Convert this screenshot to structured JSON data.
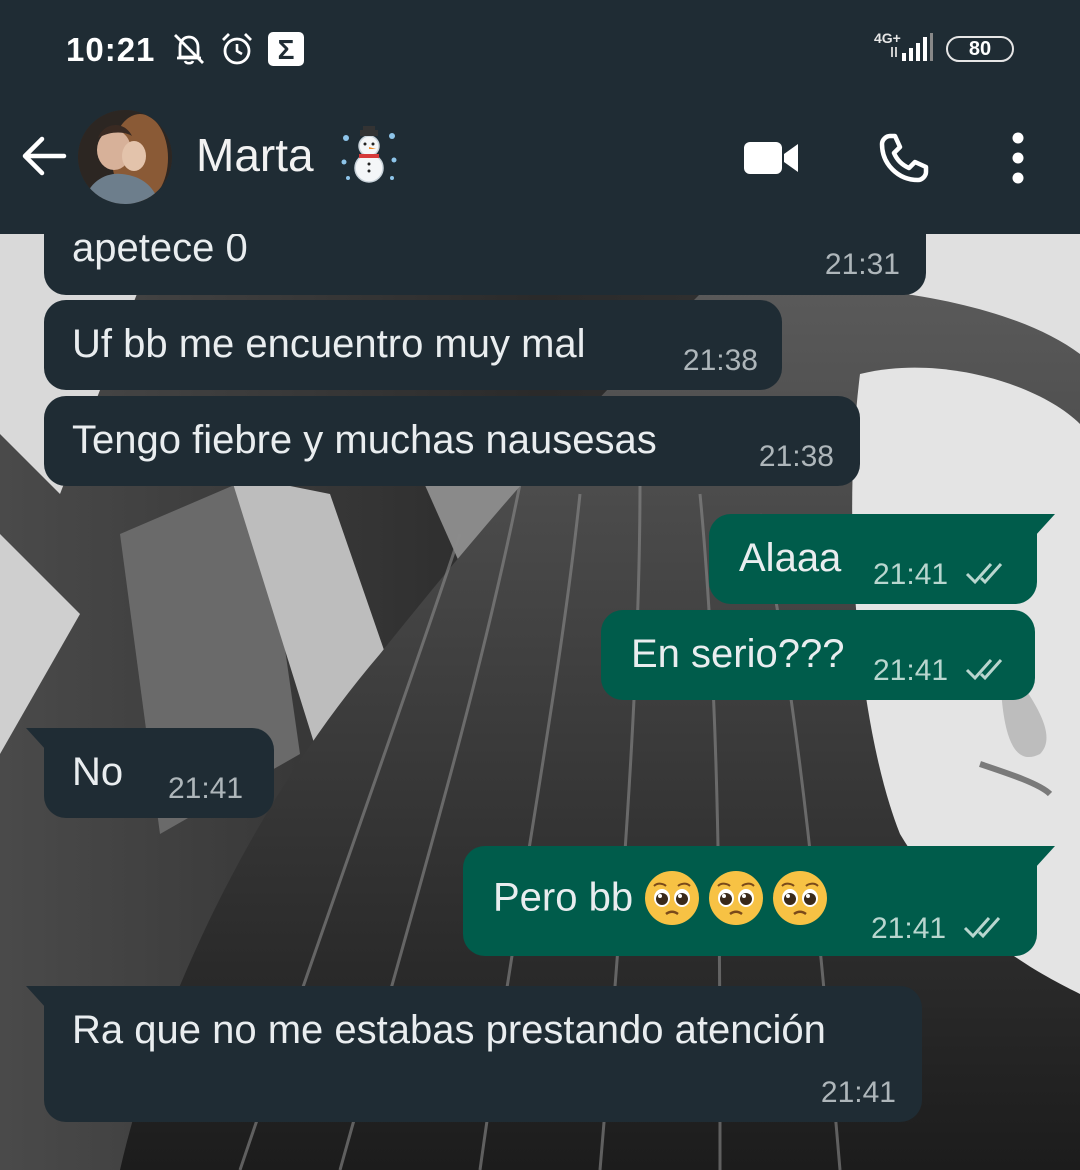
{
  "status_bar": {
    "time": "10:21",
    "network": "4G+",
    "battery": "80",
    "icons": [
      "bell-off-icon",
      "alarm-icon",
      "sigma-icon",
      "signal-icon",
      "battery-icon"
    ]
  },
  "header": {
    "contact_name": "Marta",
    "name_emoji": "snowman-icon",
    "actions": [
      "back-arrow-icon",
      "video-call-icon",
      "voice-call-icon",
      "more-vert-icon"
    ]
  },
  "messages": [
    {
      "dir": "in",
      "text": "apetece 0",
      "time": "21:31"
    },
    {
      "dir": "in",
      "text": "Uf bb me encuentro muy mal",
      "time": "21:38"
    },
    {
      "dir": "in",
      "text": "Tengo fiebre y muchas nausesas",
      "time": "21:38"
    },
    {
      "dir": "out",
      "text": "Alaaa",
      "time": "21:41",
      "status": "read"
    },
    {
      "dir": "out",
      "text": "En serio???",
      "time": "21:41",
      "status": "read"
    },
    {
      "dir": "in",
      "text": "No",
      "time": "21:41"
    },
    {
      "dir": "out",
      "text": "Pero bb",
      "time": "21:41",
      "status": "read",
      "emoji": "pleading-face-icon",
      "emoji_count": 3
    },
    {
      "dir": "in",
      "text": "Ra que no me estabas prestando atención",
      "time": "21:41"
    }
  ],
  "colors": {
    "header_bg": "#1f2c34",
    "incoming_bubble": "#1f2c34",
    "outgoing_bubble": "#005c4b",
    "text": "#e9edef",
    "timestamp": "#aeb6ba"
  }
}
